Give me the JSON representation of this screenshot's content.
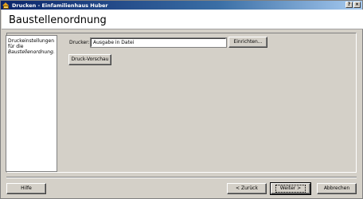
{
  "window": {
    "title": "Drucken - Einfamilienhaus Huber",
    "help_button": "?",
    "close_button": "×"
  },
  "header": {
    "title": "Baustellenordnung"
  },
  "info": {
    "line1": "Druckeinstellungen",
    "line2": "für die",
    "line3": "Baustellenordnung."
  },
  "printer": {
    "label": "Drucker:",
    "value": "Ausgabe in Datei",
    "setup_button": "Einrichten..."
  },
  "preview_button": "Druck-Vorschau",
  "footer": {
    "help": "Hilfe",
    "back": "< Zurück",
    "next": "Weiter >",
    "cancel": "Abbrechen"
  }
}
